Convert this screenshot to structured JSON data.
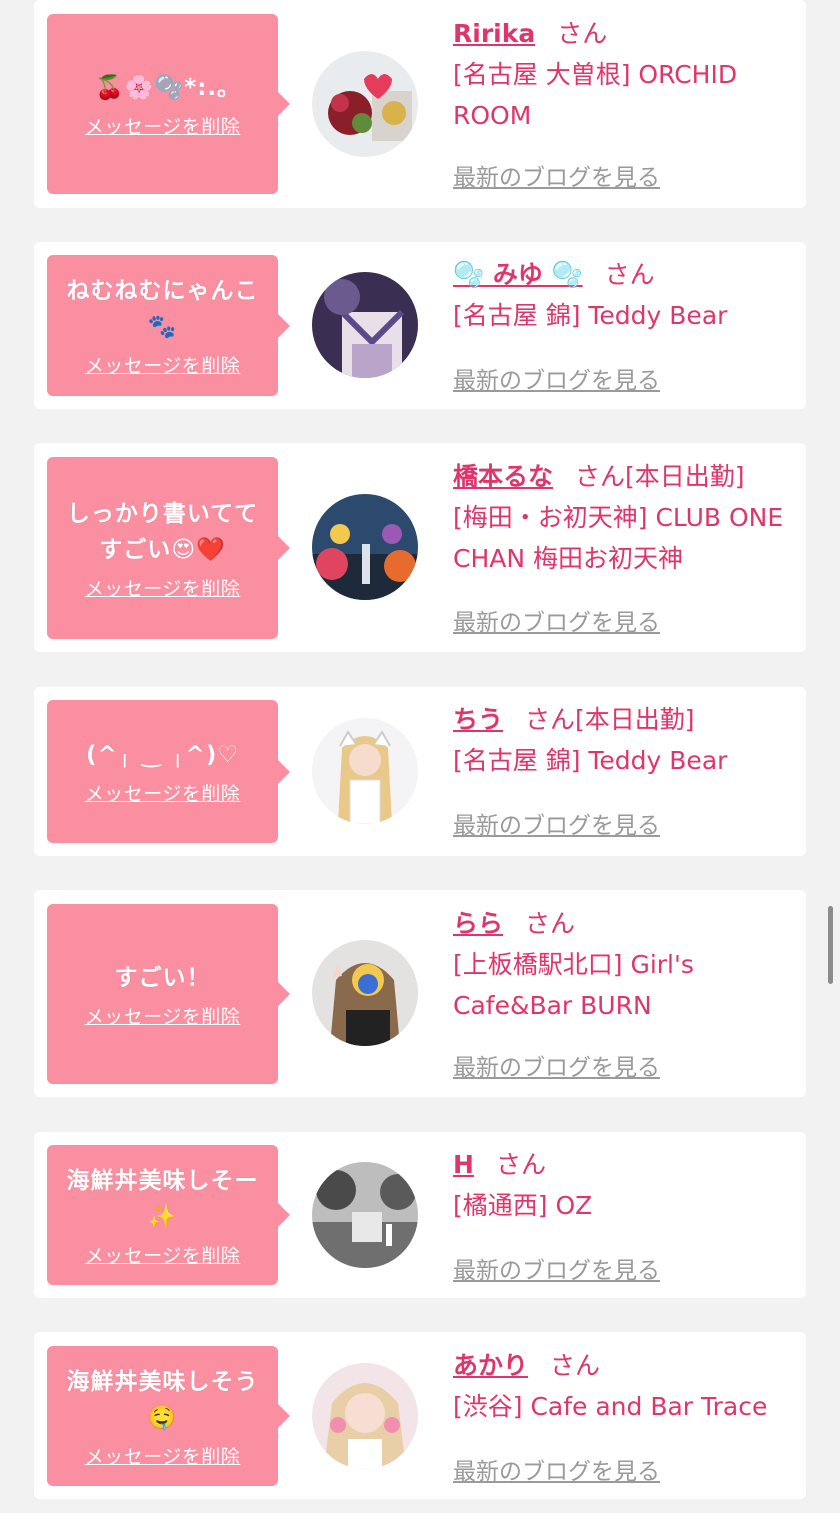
{
  "delete_label": "メッセージを削除",
  "blog_label": "最新のブログを見る",
  "suffix": "さん",
  "cards": [
    {
      "message": "🍒🌸🫧*:.｡",
      "name": "Ririka",
      "status": "",
      "shop": "[名古屋 大曽根] ORCHID ROOM"
    },
    {
      "message": "ねむねむにゃんこ\n🐾",
      "name": "🫧 みゆ 🫧",
      "status": "",
      "shop": "[名古屋 錦] Teddy Bear"
    },
    {
      "message": "しっかり書いてて\nすごい😍❤️",
      "name": "橋本るな",
      "status": "[本日出勤]",
      "shop": "[梅田・お初天神] CLUB ONE CHAN 梅田お初天神"
    },
    {
      "message": "(^╷ ‿ ╷^)♡",
      "name": "ちう",
      "status": "[本日出勤]",
      "shop": "[名古屋 錦] Teddy Bear"
    },
    {
      "message": "すごい！",
      "name": "らら",
      "status": "",
      "shop": "[上板橋駅北口] Girl's Cafe&Bar BURN"
    },
    {
      "message": "海鮮丼美味しそー\n✨",
      "name": "H",
      "status": "",
      "shop": "[橘通西] OZ"
    },
    {
      "message": "海鮮丼美味しそう\n🤤",
      "name": "あかり",
      "status": "",
      "shop": "[渋谷] Cafe and Bar Trace"
    }
  ]
}
